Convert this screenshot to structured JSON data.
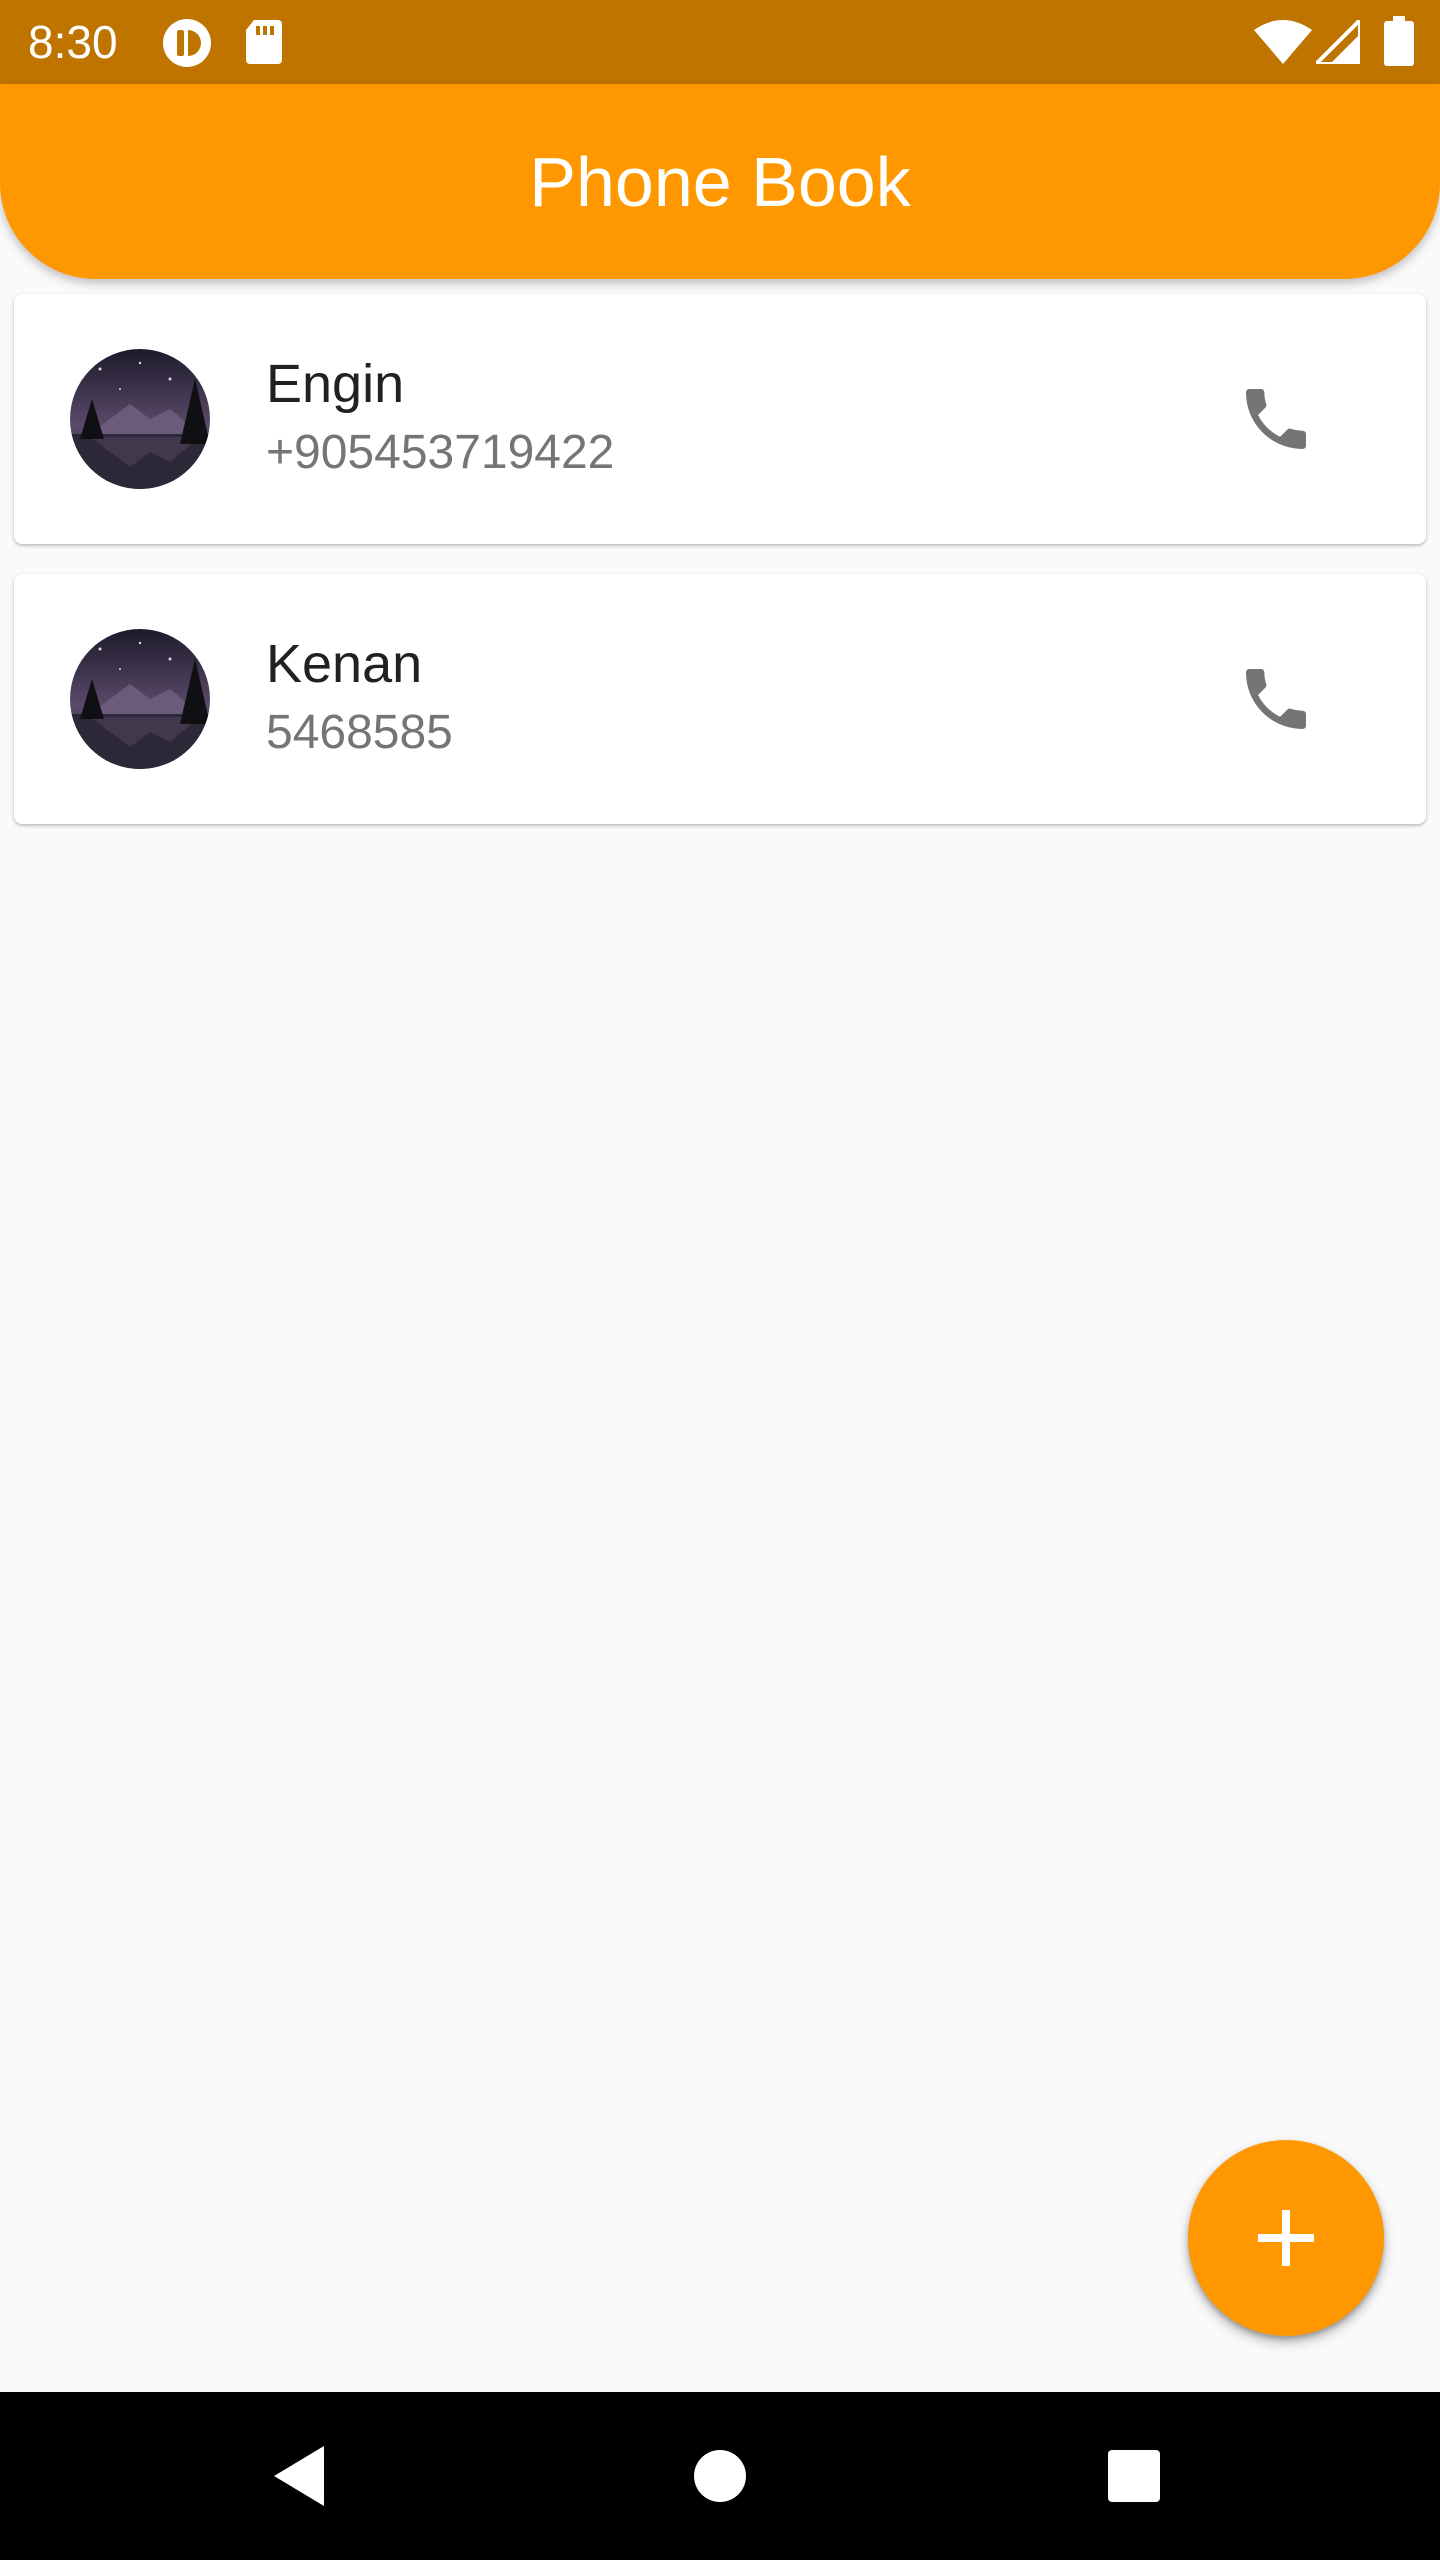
{
  "status_bar": {
    "time": "8:30",
    "left_icons": [
      "app-notification-icon",
      "sd-card-icon"
    ],
    "right_icons": [
      "wifi-icon",
      "cell-signal-icon",
      "battery-icon"
    ],
    "background": "#c07400"
  },
  "app_bar": {
    "title": "Phone Book",
    "background": "#ff9800"
  },
  "contacts": [
    {
      "name": "Engin",
      "phone": "+905453719422",
      "avatar_icon": "avatar-image",
      "action_icon": "phone-icon"
    },
    {
      "name": "Kenan",
      "phone": "5468585",
      "avatar_icon": "avatar-image",
      "action_icon": "phone-icon"
    }
  ],
  "fab": {
    "icon": "add-icon",
    "background": "#ff9800"
  },
  "nav_bar": {
    "buttons": [
      "back-icon",
      "home-icon",
      "recents-icon"
    ]
  }
}
